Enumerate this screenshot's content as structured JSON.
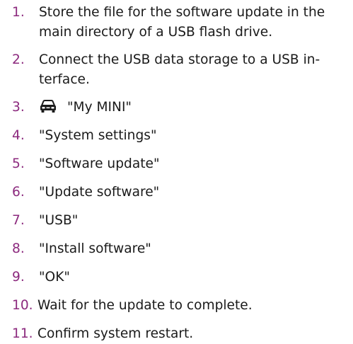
{
  "colors": {
    "number": "#8c2a7e",
    "text": "#1a1a1a",
    "background": "#ffffff"
  },
  "steps": [
    {
      "number": "1.",
      "text": "Store the file for the software update in the main directory of a USB flash drive."
    },
    {
      "number": "2.",
      "text": "Connect the USB data storage to a USB in­terface."
    },
    {
      "number": "3.",
      "icon": "car-icon",
      "text": "\"My MINI\""
    },
    {
      "number": "4.",
      "text": "\"System settings\""
    },
    {
      "number": "5.",
      "text": "\"Software update\""
    },
    {
      "number": "6.",
      "text": "\"Update software\""
    },
    {
      "number": "7.",
      "text": "\"USB\""
    },
    {
      "number": "8.",
      "text": "\"Install software\""
    },
    {
      "number": "9.",
      "text": "\"OK\""
    },
    {
      "number": "10.",
      "text": "Wait for the update to complete."
    },
    {
      "number": "11.",
      "text": "Confirm system restart."
    }
  ]
}
